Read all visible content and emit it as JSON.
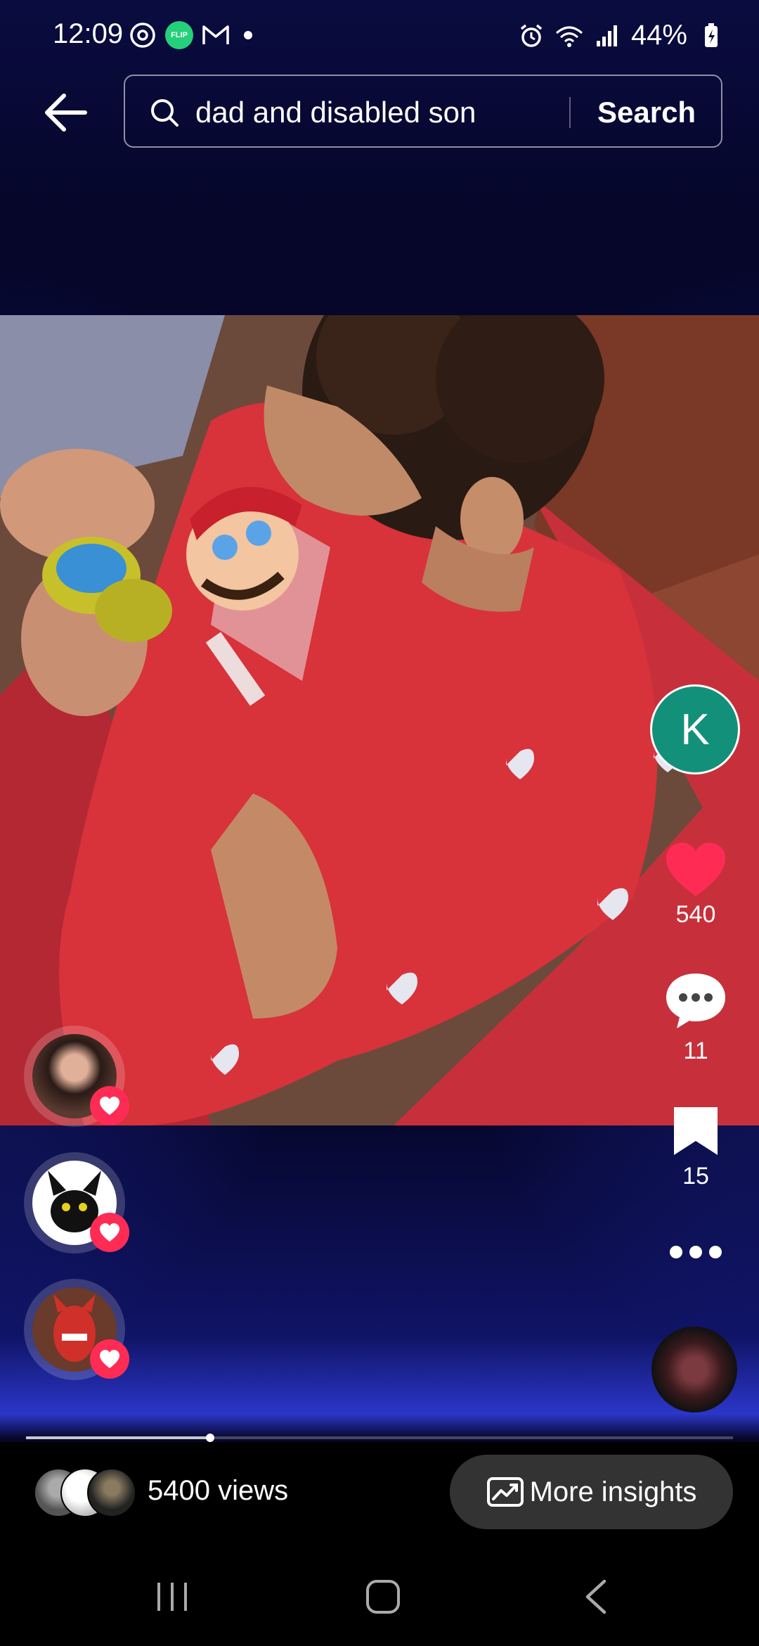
{
  "status_bar": {
    "time": "12:09",
    "battery": "44%",
    "icons": [
      "threads-icon",
      "flip-app-icon",
      "gmail-icon",
      "notification-dot",
      "alarm-icon",
      "wifi-6e-icon",
      "signal-icon",
      "battery-charging-icon"
    ],
    "flip_label": "FLIP"
  },
  "search": {
    "query": "dad and disabled son",
    "button_label": "Search"
  },
  "creator": {
    "initial": "K",
    "avatar_color": "#13907a"
  },
  "actions": {
    "likes": "540",
    "comments": "11",
    "saves": "15"
  },
  "likers": [
    {
      "name": "liker-1",
      "color": "#5a3a30"
    },
    {
      "name": "liker-2",
      "color": "#ffffff"
    },
    {
      "name": "liker-3",
      "color": "#c83a2a"
    }
  ],
  "progress": {
    "played_fraction": 0.26
  },
  "footer": {
    "views": "5400 views",
    "insights_label": "More insights"
  },
  "colors": {
    "like_red": "#fe2c55",
    "bottom_bar": "#000000",
    "insights_button": "#333333"
  }
}
